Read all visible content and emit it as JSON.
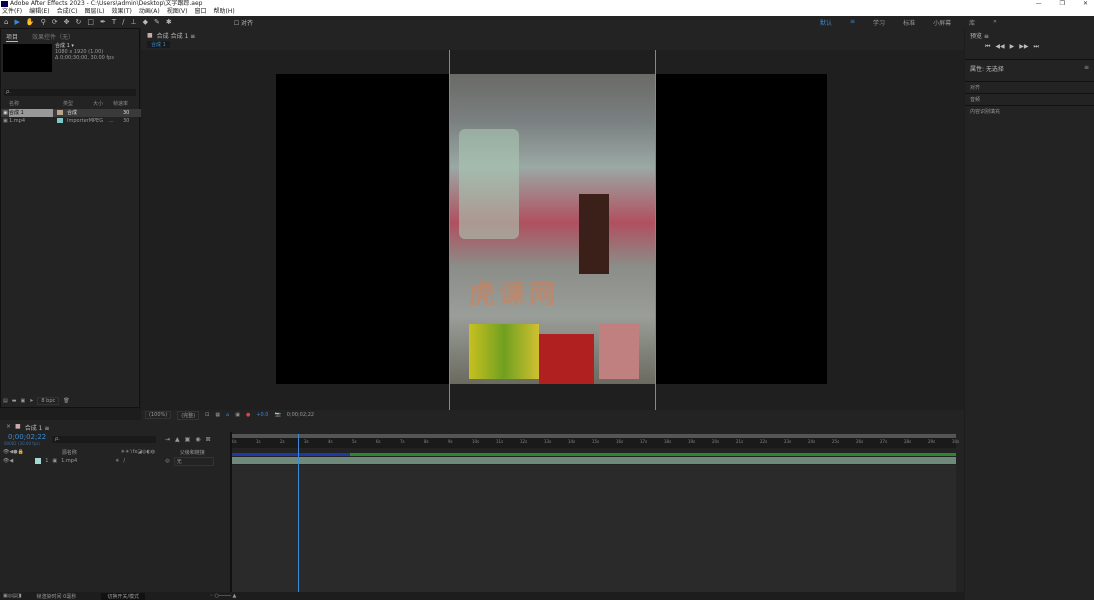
{
  "window": {
    "title": "Adobe After Effects 2023 - C:\\Users\\admin\\Desktop\\文字跟踪.aep",
    "controls": [
      "—",
      "❐",
      "✕"
    ]
  },
  "menu": [
    "文件(F)",
    "编辑(E)",
    "合成(C)",
    "图层(L)",
    "效果(T)",
    "动画(A)",
    "视图(V)",
    "窗口",
    "帮助(H)"
  ],
  "toolbar": {
    "snap_label": "对齐",
    "workspaces": [
      "默认",
      "≡",
      "学习",
      "标准",
      "小屏幕",
      "库",
      "»"
    ]
  },
  "project": {
    "tabs": [
      "项目",
      "效果控件（无）"
    ],
    "selected_name": "合成 1 ▾",
    "selected_info1": "1080 x 1920 (1.00)",
    "selected_info2": "Δ 0;00;30;00, 30.00 fps",
    "search_placeholder": "ρ.",
    "columns": [
      "名称",
      "类型",
      "大小",
      "帧速率"
    ],
    "items": [
      {
        "name": "合成 1",
        "type": "合成",
        "size": "",
        "fps": "30"
      },
      {
        "name": "1.mp4",
        "type": "ImporterMPEG",
        "size": "...",
        "fps": "30"
      }
    ],
    "bpc": "8 bpc"
  },
  "comp": {
    "tab": "合成 合成 1 ≡",
    "subtab": "合成 1",
    "zoom": "(100%)",
    "quality": "(完整)",
    "exposure": "+0.0",
    "timecode": "0;00;02;22",
    "watermark": "虎课网"
  },
  "right": {
    "preview_title": "预览 ≡",
    "properties_title": "属性: 无选择",
    "sections": [
      "对齐",
      "音频",
      "内容识别填充"
    ]
  },
  "timeline": {
    "tab": "合成 1 ≡",
    "timecode": "0;00;02;22",
    "frame_info": "00082 (30.00 fps)",
    "search_placeholder": "ρ.",
    "columns": [
      "源名称",
      "父级和链接"
    ],
    "layer": {
      "index": "1",
      "name": "1.mp4",
      "parent": "无"
    },
    "ruler": [
      "0s",
      "1s",
      "2s",
      "3s",
      "4s",
      "5s",
      "6s",
      "7s",
      "8s",
      "9s",
      "10s",
      "11s",
      "12s",
      "13s",
      "14s",
      "15s",
      "16s",
      "17s",
      "18s",
      "19s",
      "20s",
      "21s",
      "22s",
      "23s",
      "24s",
      "25s",
      "26s",
      "27s",
      "28s",
      "29s",
      "30s"
    ],
    "playhead_seconds": 2.73,
    "duration_seconds": 30,
    "footer_render": "帧渲染时间 0毫秒",
    "footer_toggle": "切换开关/模式"
  },
  "colors": {
    "accent": "#3a8ad6",
    "track": "#6f8a7a",
    "cache_green": "#2a8a2a",
    "cache_blue": "#1c3aa0"
  }
}
